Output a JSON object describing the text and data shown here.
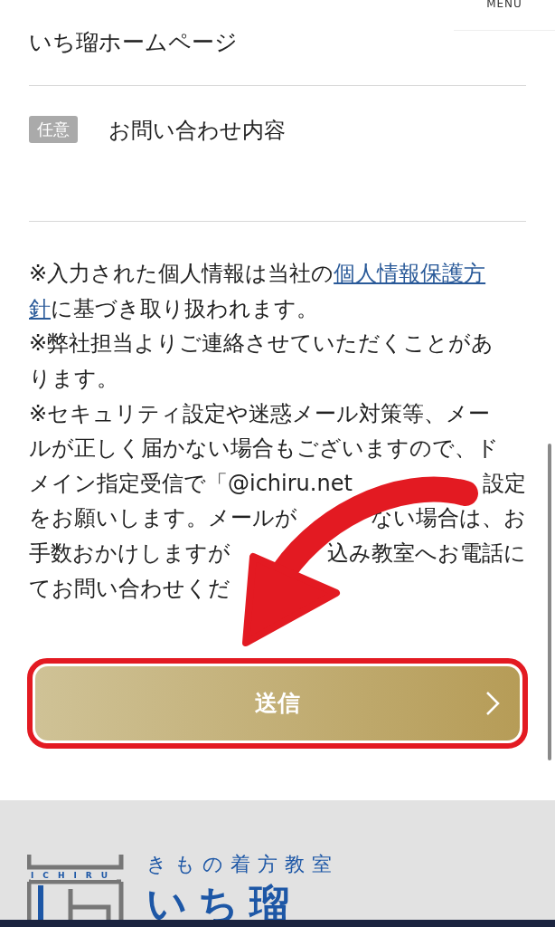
{
  "header": {
    "menu_label": "MENU"
  },
  "form_rows": [
    {
      "kind": "value",
      "text": "いち瑠ホームページ"
    },
    {
      "kind": "field",
      "badge": "任意",
      "label": "お問い合わせ内容"
    }
  ],
  "notice_lines": [
    {
      "covered": false,
      "segments": [
        {
          "kind": "text",
          "text": "※入力された個人情報は当社の"
        },
        {
          "kind": "link",
          "text": "個人情報保護方"
        }
      ]
    },
    {
      "covered": false,
      "segments": [
        {
          "kind": "link",
          "text": "針"
        },
        {
          "kind": "text",
          "text": "に基づき取り扱われます。"
        }
      ]
    },
    {
      "segments": [
        {
          "kind": "text",
          "text": "※弊社担当よりご連絡させていただくことがあ"
        }
      ]
    },
    {
      "segments": [
        {
          "kind": "text",
          "text": "ります。"
        }
      ]
    },
    {
      "segments": [
        {
          "kind": "text",
          "text": "※セキュリティ設定や迷惑メール対策等、メー"
        }
      ]
    },
    {
      "segments": [
        {
          "kind": "text",
          "text": "ルが正しく届かない場合もございますので、ド"
        }
      ]
    },
    {
      "covered": true,
      "segments": [
        {
          "kind": "text",
          "text": "メイン指定受信で「@ichiru.net"
        },
        {
          "kind": "text",
          "text": "設定"
        }
      ]
    },
    {
      "covered": true,
      "segments": [
        {
          "kind": "text",
          "text": "をお願いします。メールが"
        },
        {
          "kind": "text",
          "text": "ない場合は、お"
        }
      ]
    },
    {
      "covered": true,
      "segments": [
        {
          "kind": "text",
          "text": "手数おかけしますが"
        },
        {
          "kind": "text",
          "text": "込み教室へお電話に"
        }
      ]
    },
    {
      "segments": [
        {
          "kind": "text",
          "text": "てお問い合わせくだ"
        }
      ]
    }
  ],
  "submit_button": {
    "label": "送信",
    "highlighted": true
  },
  "footer": {
    "logo_letters": "ICHIRU",
    "subtitle": "きもの着方教室",
    "brand": "いち瑠"
  }
}
